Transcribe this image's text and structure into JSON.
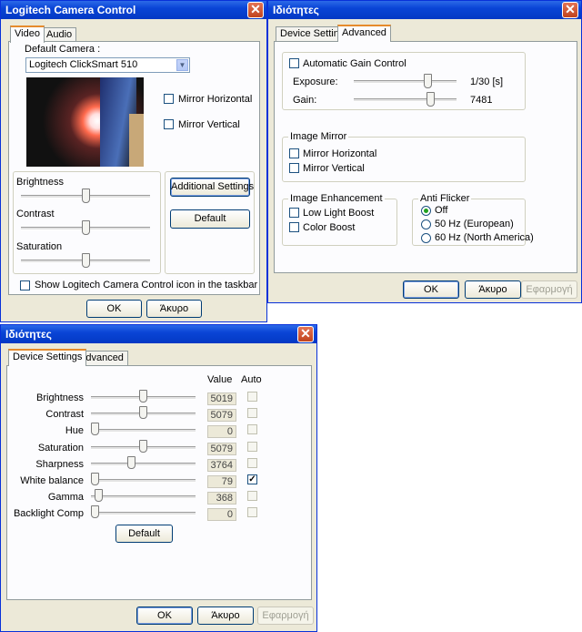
{
  "w1": {
    "title": "Logitech Camera Control",
    "tabs": [
      "Video",
      "Audio"
    ],
    "camera_label": "Default Camera :",
    "camera_value": "Logitech ClickSmart 510",
    "mirror_h": "Mirror Horizontal",
    "mirror_v": "Mirror Vertical",
    "brightness": "Brightness",
    "contrast": "Contrast",
    "saturation": "Saturation",
    "levels": {
      "brightness": 0.5,
      "contrast": 0.5,
      "saturation": 0.5
    },
    "additional": "Additional Settings",
    "default": "Default",
    "taskbar": "Show Logitech Camera Control icon in the taskbar",
    "ok": "OK",
    "cancel": "Άκυρο"
  },
  "w2": {
    "title": "Ιδιότητες",
    "tabs": [
      "Device Settings",
      "Advanced"
    ],
    "agc": "Automatic Gain Control",
    "exposure_label": "Exposure:",
    "exposure_value": "1/30 [s]",
    "gain_label": "Gain:",
    "gain_value": "7481",
    "image_mirror": "Image Mirror",
    "mirror_h": "Mirror Horizontal",
    "mirror_v": "Mirror Vertical",
    "image_enh": "Image Enhancement",
    "low_light": "Low Light Boost",
    "color_boost": "Color Boost",
    "anti_flicker": "Anti Flicker",
    "flicker_options": [
      "Off",
      "50 Hz (European)",
      "60 Hz (North America)"
    ],
    "flicker_selected": "Off",
    "ok": "OK",
    "cancel": "Άκυρο",
    "apply": "Εφαρμογή"
  },
  "w3": {
    "title": "Ιδιότητες",
    "tabs": [
      "Device Settings",
      "Advanced"
    ],
    "col_value": "Value",
    "col_auto": "Auto",
    "rows": [
      {
        "label": "Brightness",
        "value": "5019",
        "auto": false,
        "level": 0.5
      },
      {
        "label": "Contrast",
        "value": "5079",
        "auto": false,
        "level": 0.5
      },
      {
        "label": "Hue",
        "value": "0",
        "auto": false,
        "level": 0.0
      },
      {
        "label": "Saturation",
        "value": "5079",
        "auto": false,
        "level": 0.5
      },
      {
        "label": "Sharpness",
        "value": "3764",
        "auto": false,
        "level": 0.38
      },
      {
        "label": "White balance",
        "value": "79",
        "auto": true,
        "level": 0.0
      },
      {
        "label": "Gamma",
        "value": "368",
        "auto": false,
        "level": 0.04
      },
      {
        "label": "Backlight Comp",
        "value": "0",
        "auto": false,
        "level": 0.0
      }
    ],
    "default": "Default",
    "ok": "OK",
    "cancel": "Άκυρο",
    "apply": "Εφαρμογή"
  }
}
